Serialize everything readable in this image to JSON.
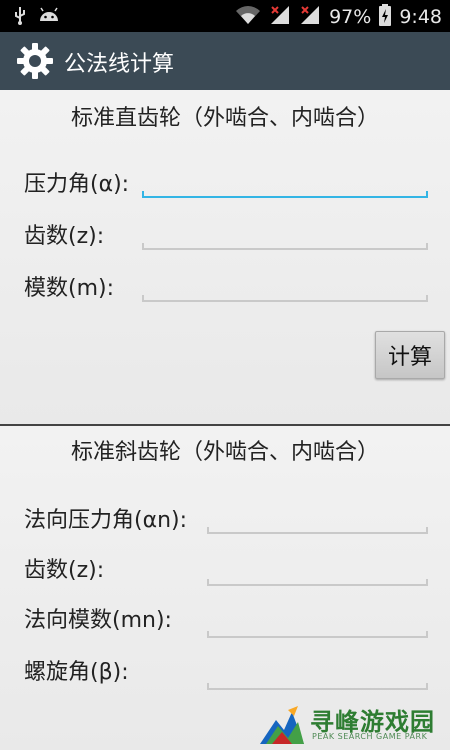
{
  "status_bar": {
    "battery_percent": "97%",
    "time": "9:48"
  },
  "action_bar": {
    "title": "公法线计算",
    "icon": "gear-icon"
  },
  "section_spur": {
    "title": "标准直齿轮（外啮合、内啮合）",
    "fields": [
      {
        "label": "压力角(α):",
        "value": "",
        "focused": true
      },
      {
        "label": "齿数(z):",
        "value": ""
      },
      {
        "label": "模数(m):",
        "value": ""
      }
    ],
    "button_label": "计算"
  },
  "section_helical": {
    "title": "标准斜齿轮（外啮合、内啮合）",
    "fields": [
      {
        "label": "法向压力角(αn):",
        "value": ""
      },
      {
        "label": "齿数(z):",
        "value": ""
      },
      {
        "label": "法向模数(mn):",
        "value": ""
      },
      {
        "label": "螺旋角(β):",
        "value": ""
      }
    ]
  },
  "watermark": {
    "text": "寻峰游戏园",
    "subtext": "PEAK SEARCH GAME PARK"
  },
  "colors": {
    "action_bar": "#3b4a55",
    "focus_accent": "#33b5e5",
    "status_bar": "#000000"
  }
}
